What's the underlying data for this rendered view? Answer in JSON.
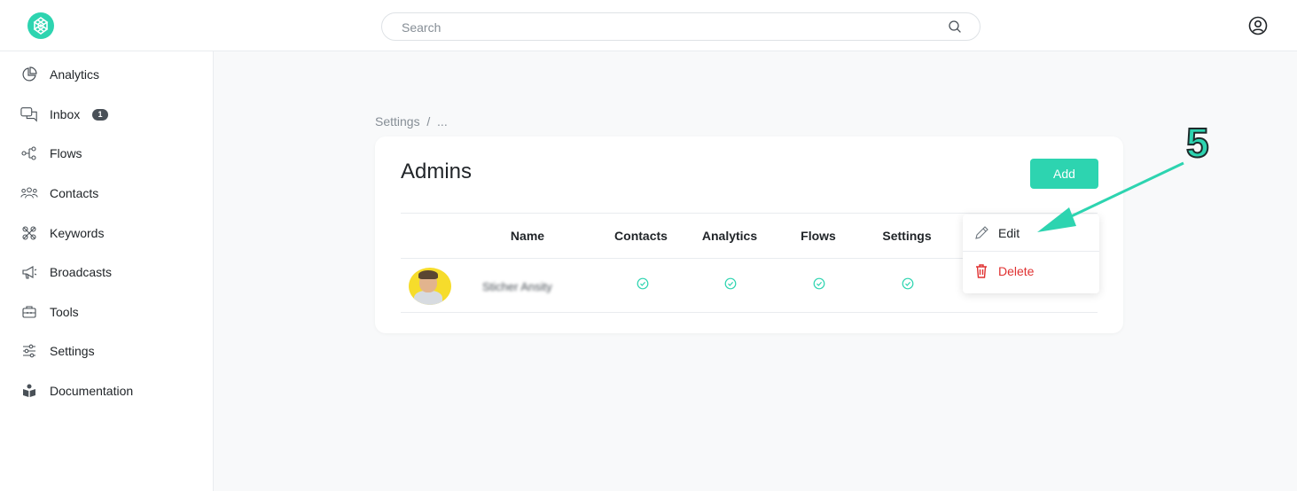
{
  "search": {
    "placeholder": "Search"
  },
  "sidebar": {
    "items": [
      {
        "label": "Analytics"
      },
      {
        "label": "Inbox",
        "badge": "1"
      },
      {
        "label": "Flows"
      },
      {
        "label": "Contacts"
      },
      {
        "label": "Keywords"
      },
      {
        "label": "Broadcasts"
      },
      {
        "label": "Tools"
      },
      {
        "label": "Settings"
      },
      {
        "label": "Documentation"
      }
    ]
  },
  "breadcrumb": "Settings  /  ...",
  "card": {
    "title": "Admins",
    "add_label": "Add",
    "columns": [
      "Name",
      "Contacts",
      "Analytics",
      "Flows",
      "Settings"
    ],
    "rows": [
      {
        "name": "Sticher Ansity",
        "contacts": true,
        "analytics": true,
        "flows": true,
        "settings": true
      }
    ]
  },
  "menu": {
    "edit_label": "Edit",
    "delete_label": "Delete"
  },
  "annotation": {
    "step": "5"
  },
  "colors": {
    "accent": "#2dd4b0",
    "danger": "#e03131",
    "text": "#212529"
  }
}
